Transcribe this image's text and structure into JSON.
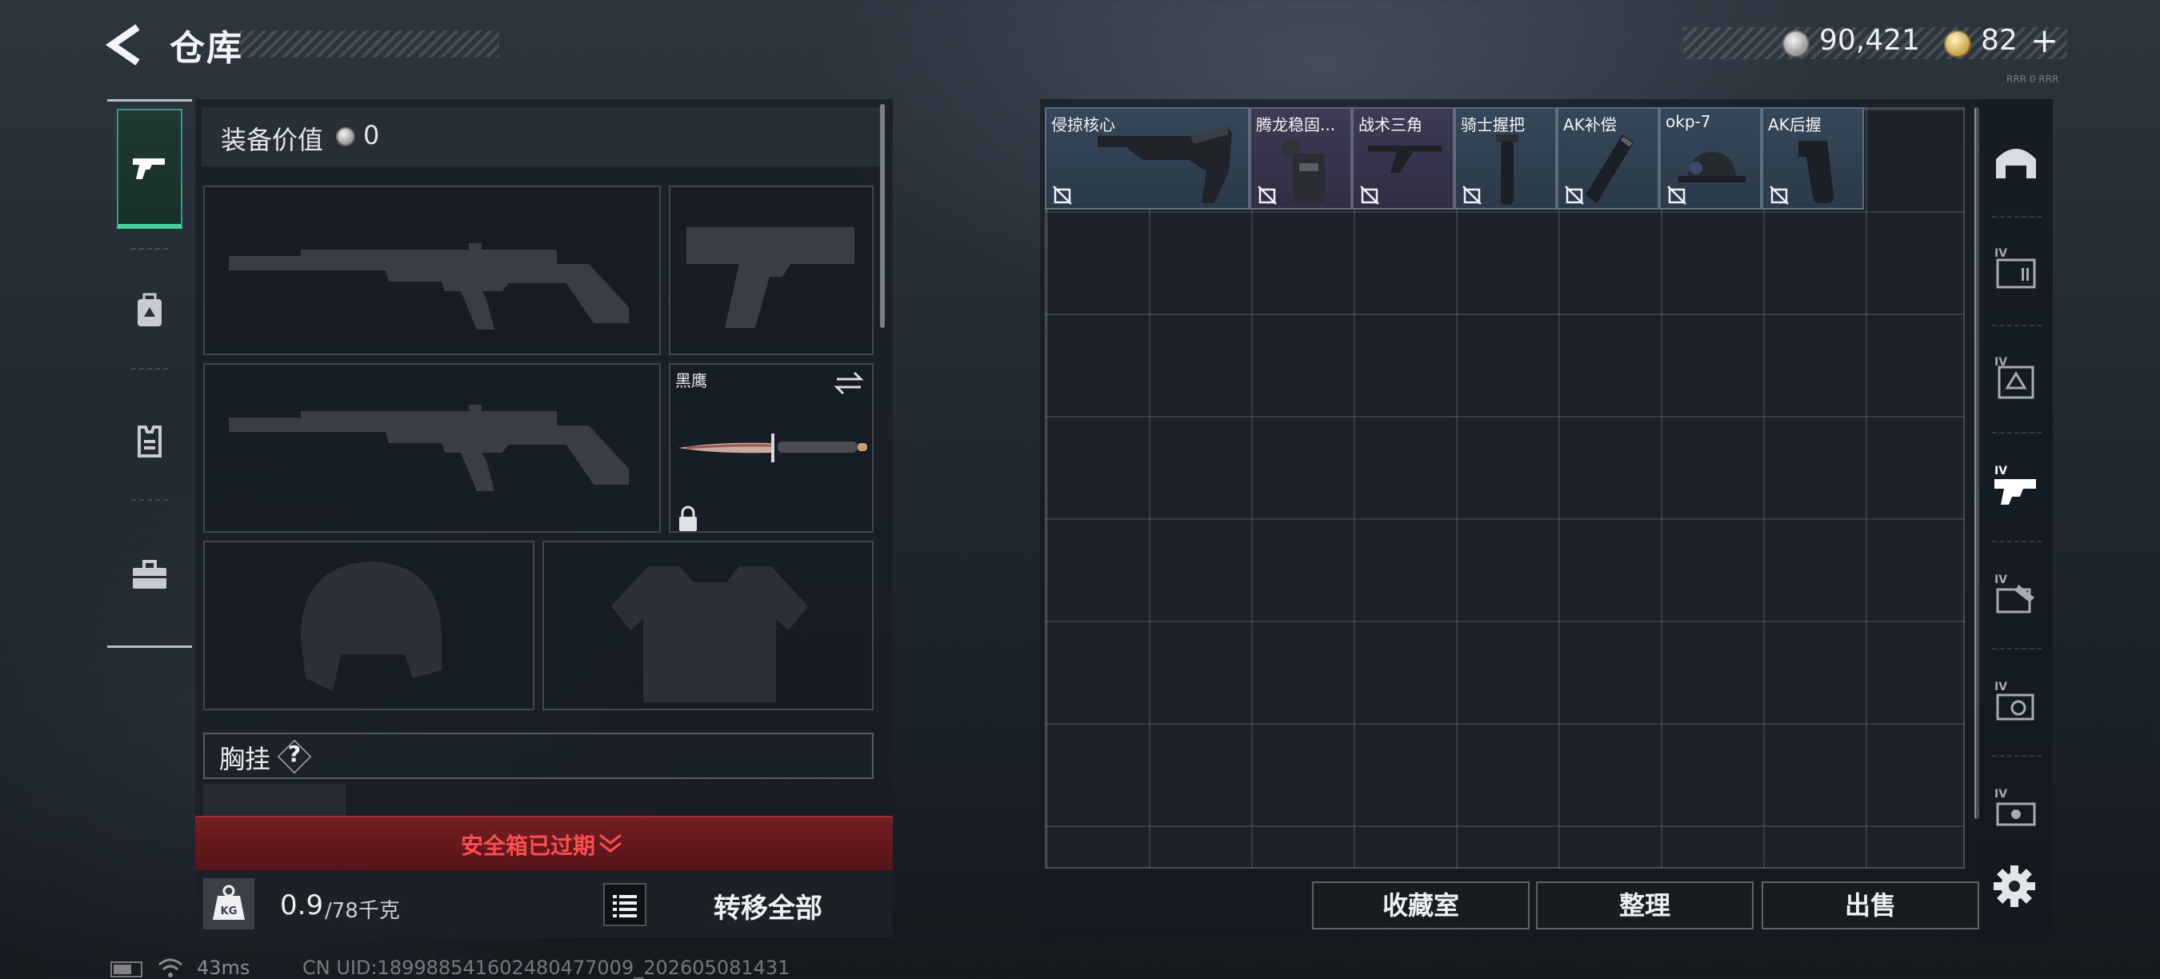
{
  "header": {
    "title": "仓库",
    "currency": {
      "silver": "90,421",
      "gold": "82",
      "plus_label": "+"
    },
    "tiny_label": "RRR 0 RRR"
  },
  "left_tabs": [
    {
      "icon": "pistol-icon",
      "active": true
    },
    {
      "icon": "backpack-icon",
      "active": false
    },
    {
      "icon": "vest-icon",
      "active": false
    },
    {
      "icon": "toolbox-icon",
      "active": false
    }
  ],
  "equipment": {
    "value_label": "装备价值",
    "value": "0",
    "knife": {
      "name": "黑鹰"
    },
    "chest_rig": {
      "label": "胸挂",
      "help": "?"
    },
    "expired_text": "安全箱已过期",
    "weight": {
      "current": "0.9",
      "max": "/78千克",
      "icon_label": "KG"
    },
    "transfer_all": "转移全部"
  },
  "storage": {
    "items": [
      {
        "name": "侵掠核心",
        "rarity": "blue",
        "icon": "rifle-stock-icon"
      },
      {
        "name": "腾龙稳固...",
        "rarity": "purple",
        "icon": "stock-adapter-icon"
      },
      {
        "name": "战术三角",
        "rarity": "purple",
        "icon": "angled-grip-icon"
      },
      {
        "name": "骑士握把",
        "rarity": "blue",
        "icon": "vertical-grip-icon"
      },
      {
        "name": "AK补偿",
        "rarity": "blue",
        "icon": "compensator-icon"
      },
      {
        "name": "okp-7",
        "rarity": "blue",
        "icon": "red-dot-sight-icon"
      },
      {
        "name": "AK后握",
        "rarity": "blue",
        "icon": "pistol-grip-icon"
      }
    ],
    "actions": {
      "collection": "收藏室",
      "sort": "整理",
      "sell": "出售"
    }
  },
  "right_tabs": [
    {
      "icon": "all-items-icon"
    },
    {
      "icon": "ammo-category-icon"
    },
    {
      "icon": "medical-category-icon"
    },
    {
      "icon": "weapon-parts-category-icon",
      "active": true
    },
    {
      "icon": "tools-category-icon"
    },
    {
      "icon": "valuables-category-icon"
    },
    {
      "icon": "misc-category-icon"
    }
  ],
  "status": {
    "ping": "43ms",
    "uid": "CN UID:18998854160248047700​9_202605081431"
  },
  "colors": {
    "accent_green": "#3ed39a",
    "expired_red": "#ff4d4d",
    "item_blue": "#35475a",
    "item_purple": "#3d3a55"
  }
}
